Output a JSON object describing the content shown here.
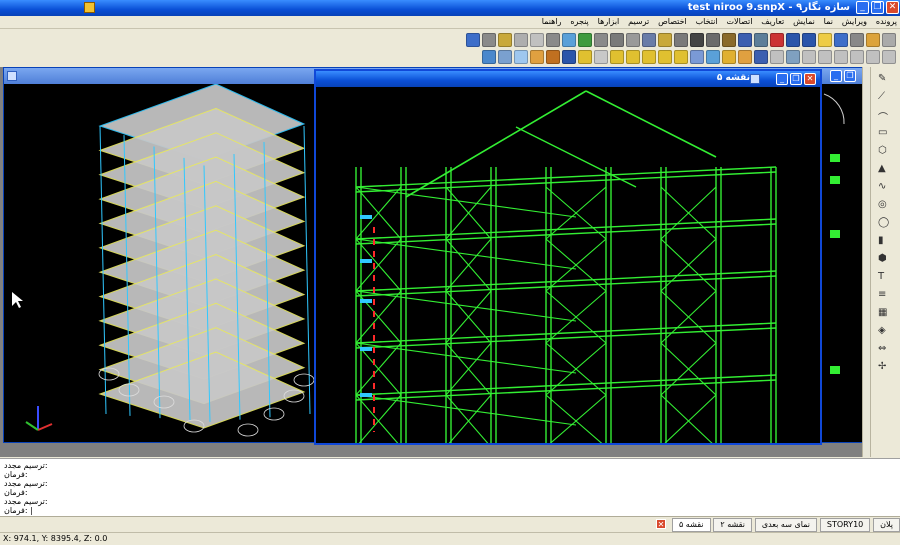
{
  "window": {
    "title": "test niroo 9.snpX - سازه نگار۹"
  },
  "menu": [
    "پرونده",
    "ویرایش",
    "نما",
    "نمایش",
    "تعاریف",
    "اتصالات",
    "انتخاب",
    "اختصاص",
    "ترسیم",
    "ابزارها",
    "پنجره",
    "راهنما"
  ],
  "toolbar1_colors": [
    "#3d6ec9",
    "#8a8a8a",
    "#c9a93b",
    "#aeaeae",
    "#c0c0c0",
    "#8a8a8a",
    "#5aa0d8",
    "#3f9a3f",
    "#8a8a8a",
    "#7a7a7a",
    "#999999",
    "#6a7da8",
    "#c9a93b",
    "#7a7a7a",
    "#444444",
    "#6b6b6b",
    "#8a6a2a",
    "#3c5fb0",
    "#5d7f99",
    "#cc3333",
    "#2a55aa",
    "#2a55aa",
    "#eecc44",
    "#3d6ec9",
    "#888888",
    "#dca33a",
    "#aaaaaa"
  ],
  "toolbar2_colors": [
    "#4a88cc",
    "#7aa0cf",
    "#9ec7ef",
    "#e0a040",
    "#c07020",
    "#2a55aa",
    "#e0c030",
    "#c8c8c8",
    "#e0c030",
    "#e0c030",
    "#e0c030",
    "#e0c030",
    "#e0c030",
    "#7a9ad6",
    "#5aa0d8",
    "#e0b030",
    "#e0a040",
    "#3c5fb0",
    "#c0c0c0",
    "#7fa0c0",
    "#c0c0c0",
    "#c0c0c0",
    "#c0c0c0",
    "#c0c0c0",
    "#c0c0c0",
    "#c0c0c0"
  ],
  "windows": {
    "view3d": {
      "title": ""
    },
    "plan5": {
      "title": "نقشه ۵"
    }
  },
  "command_lines": [
    "ترسیم مجدد:",
    "فرمان:",
    "ترسیم مجدد:",
    "فرمان:",
    "ترسیم مجدد:",
    "فرمان: |"
  ],
  "tabs": [
    "پلان",
    "STORY10",
    "نمای سه بعدی",
    "نقشه ۲",
    "نقشه ۵"
  ],
  "status": {
    "coords": "X: 974.1, Y: 8395.4, Z: 0.0"
  },
  "colors": {
    "accent": "#0a4fd6",
    "frame_green": "#33ee33",
    "slab_grey": "#c8c8c8",
    "grid_cyan": "#30c8ff"
  }
}
